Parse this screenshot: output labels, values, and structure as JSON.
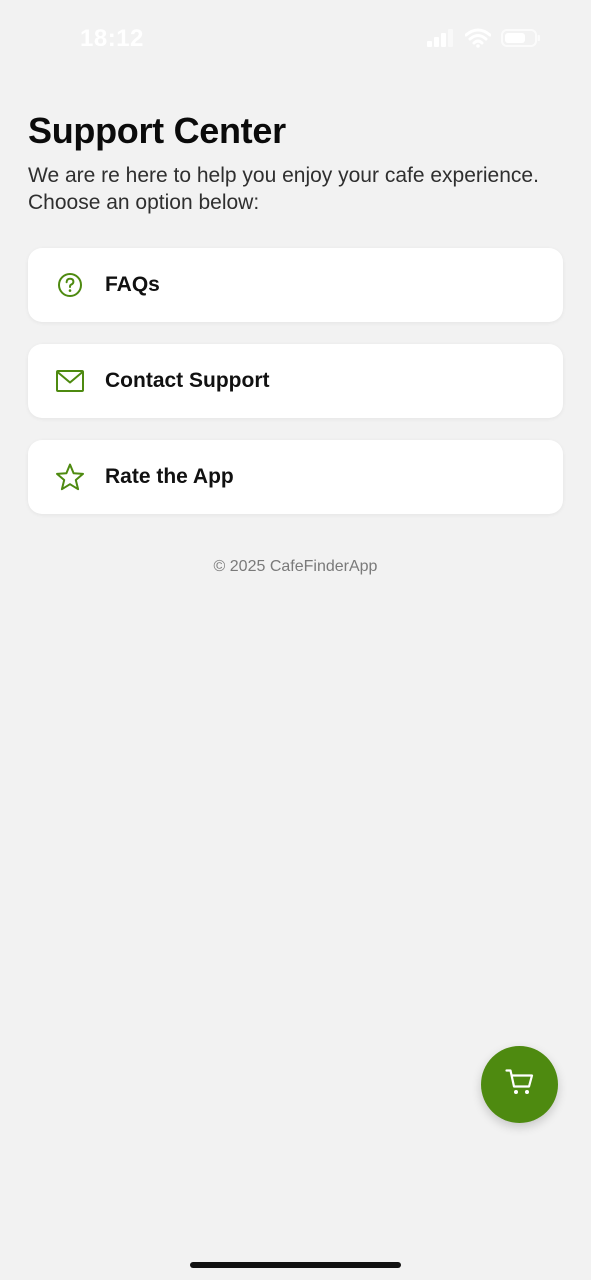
{
  "status_bar": {
    "time": "18:12",
    "icons": [
      "cellular-signal-icon",
      "wifi-icon",
      "battery-icon"
    ]
  },
  "header": {
    "title": "Support Center",
    "subtitle": "We are re here to help you enjoy your cafe experience. Choose an option below:"
  },
  "options": [
    {
      "label": "FAQs",
      "icon": "help-circle-icon"
    },
    {
      "label": "Contact Support",
      "icon": "mail-icon"
    },
    {
      "label": "Rate the App",
      "icon": "star-icon"
    }
  ],
  "footer": {
    "text": "© 2025 CafeFinderApp"
  },
  "cart_button": {
    "icon": "shopping-cart-icon"
  },
  "colors": {
    "accent": "#4e8a10",
    "background": "#f2f2f2",
    "card": "#ffffff"
  }
}
